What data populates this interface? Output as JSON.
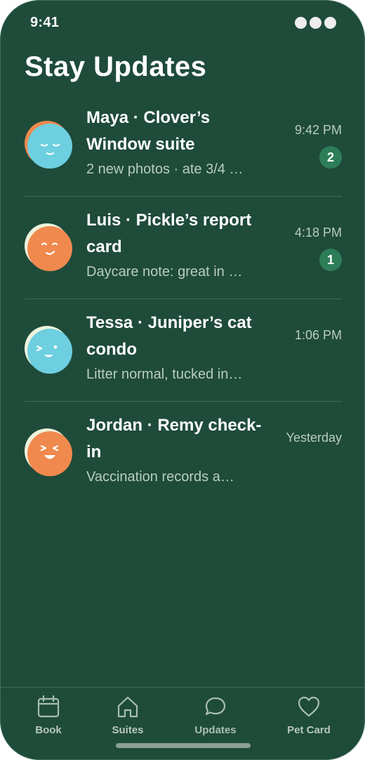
{
  "status_bar": {
    "time": "9:41"
  },
  "page_title": "Stay Updates",
  "threads": [
    {
      "title": "Maya · Clover’s Window suite",
      "preview": "2 new photos · ate 3/4 …",
      "time": "9:42 PM",
      "unread": "2",
      "avatar": "sleepy-face-icon",
      "avatar_colors": {
        "face": "#6dcfe0",
        "back": "#f0894e"
      }
    },
    {
      "title": "Luis · Pickle’s report card",
      "preview": "Daycare note: great in …",
      "time": "4:18 PM",
      "unread": "1",
      "avatar": "smirk-face-icon",
      "avatar_colors": {
        "face": "#f0894e",
        "back": "#eef3dc"
      }
    },
    {
      "title": "Tessa · Juniper’s cat condo",
      "preview": "Litter normal, tucked in…",
      "time": "1:06 PM",
      "unread": null,
      "avatar": "wink-face-icon",
      "avatar_colors": {
        "face": "#6dcfe0",
        "back": "#eef3dc"
      }
    },
    {
      "title": "Jordan · Remy check-in",
      "preview": "Vaccination records a…",
      "time": "Yesterday",
      "unread": null,
      "avatar": "laughing-face-icon",
      "avatar_colors": {
        "face": "#f0894e",
        "back": "#eef3dc"
      }
    }
  ],
  "tab_bar": {
    "book": {
      "label": "Book",
      "icon": "calendar-icon"
    },
    "suites": {
      "label": "Suites",
      "icon": "home-icon"
    },
    "updates": {
      "label": "Updates",
      "icon": "chat-bubble-icon",
      "active": true
    },
    "pet_card": {
      "label": "Pet Card",
      "icon": "heart-icon"
    }
  },
  "colors": {
    "background": "#1f4b3a",
    "badge": "#2d7d59",
    "muted_text": "#b9cdc3",
    "divider": "#3e6b58"
  }
}
